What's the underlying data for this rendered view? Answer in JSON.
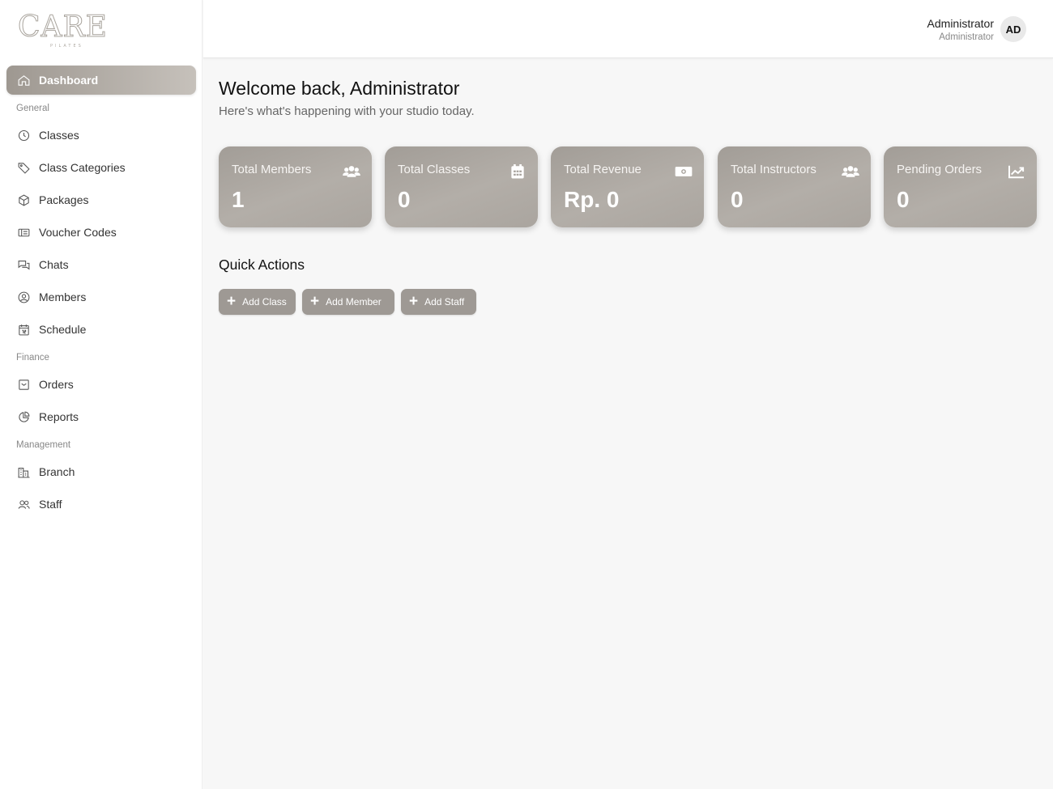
{
  "brand": {
    "logo_text": "CARE",
    "logo_sub": "PILATES"
  },
  "sidebar": {
    "dashboard": {
      "label": "Dashboard",
      "icon": "home-icon"
    },
    "sections": {
      "general": "General",
      "finance": "Finance",
      "management": "Management"
    },
    "items": [
      {
        "label": "Classes",
        "icon": "clock-icon"
      },
      {
        "label": "Class Categories",
        "icon": "tag-icon"
      },
      {
        "label": "Packages",
        "icon": "package-icon"
      },
      {
        "label": "Voucher Codes",
        "icon": "ticket-icon"
      },
      {
        "label": "Chats",
        "icon": "chat-icon"
      },
      {
        "label": "Members",
        "icon": "user-circle-icon"
      },
      {
        "label": "Schedule",
        "icon": "calendar-icon"
      },
      {
        "label": "Orders",
        "icon": "inbox-icon"
      },
      {
        "label": "Reports",
        "icon": "pie-chart-icon"
      },
      {
        "label": "Branch",
        "icon": "building-icon"
      },
      {
        "label": "Staff",
        "icon": "users-icon"
      }
    ]
  },
  "header": {
    "user_name": "Administrator",
    "user_role": "Administrator",
    "avatar_initials": "AD"
  },
  "main": {
    "welcome_title": "Welcome back, Administrator",
    "welcome_subtitle": "Here's what's happening with your studio today.",
    "stats": [
      {
        "label": "Total Members",
        "value": "1",
        "icon": "users-icon"
      },
      {
        "label": "Total Classes",
        "value": "0",
        "icon": "calendar-icon"
      },
      {
        "label": "Total Revenue",
        "value": "Rp. 0",
        "icon": "money-icon"
      },
      {
        "label": "Total Instructors",
        "value": "0",
        "icon": "users-icon"
      },
      {
        "label": "Pending Orders",
        "value": "0",
        "icon": "chart-line-icon"
      }
    ],
    "quick_actions_title": "Quick Actions",
    "quick_actions": [
      {
        "label": "Add Class"
      },
      {
        "label": "Add Member"
      },
      {
        "label": "Add Staff"
      }
    ]
  },
  "colors": {
    "accent": "#a29d97",
    "button": "#9e9994",
    "background": "#f7f7f7"
  }
}
